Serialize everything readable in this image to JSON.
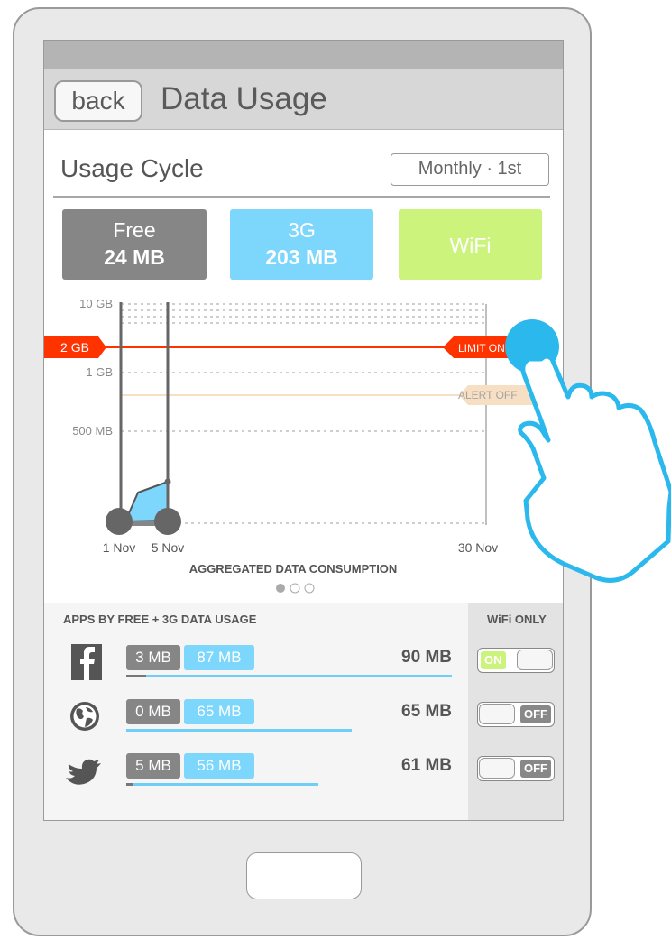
{
  "header": {
    "back_label": "back",
    "title": "Data Usage"
  },
  "cycle": {
    "label": "Usage Cycle",
    "selected": "Monthly · 1st"
  },
  "cards": {
    "free": {
      "label": "Free",
      "value": "24 MB"
    },
    "g3": {
      "label": "3G",
      "value": "203 MB"
    },
    "wifi": {
      "label": "WiFi"
    }
  },
  "chart": {
    "y_ticks": [
      "10 GB",
      "1 GB",
      "500 MB"
    ],
    "limit_value": "2 GB",
    "limit_label": "LIMIT ON",
    "alert_label": "ALERT OFF",
    "x_ticks": [
      "1 Nov",
      "5 Nov",
      "30 Nov"
    ],
    "x_title": "AGGREGATED DATA CONSUMPTION",
    "page_indicator": {
      "count": 3,
      "active": 1
    }
  },
  "chart_data": {
    "type": "area",
    "title": "",
    "xlabel": "AGGREGATED DATA CONSUMPTION",
    "ylabel": "",
    "x_range": [
      "1 Nov",
      "30 Nov"
    ],
    "y_ticks": [
      "500 MB",
      "1 GB",
      "2 GB",
      "10 GB"
    ],
    "cycle_markers": [
      "1 Nov",
      "5 Nov"
    ],
    "limit": {
      "value": "2 GB",
      "label": "LIMIT ON",
      "color": "#ff3300"
    },
    "alert": {
      "label": "ALERT OFF",
      "color": "#f7dfc4"
    },
    "series": [
      {
        "name": "3G",
        "color": "#7dd6fb"
      },
      {
        "name": "Free",
        "color": "#868686"
      }
    ]
  },
  "apps": {
    "header": "APPS BY FREE + 3G DATA USAGE",
    "wifi_header": "WiFi ONLY",
    "items": [
      {
        "icon": "facebook-icon",
        "free": "3 MB",
        "g3": "87 MB",
        "total": "90 MB",
        "wifi_only": "ON",
        "free_share": 0.04,
        "bar_share": 1.0
      },
      {
        "icon": "globe-icon",
        "free": "0 MB",
        "g3": "65 MB",
        "total": "65 MB",
        "wifi_only": "OFF",
        "free_share": 0.0,
        "bar_share": 0.72
      },
      {
        "icon": "twitter-bird-icon",
        "free": "5 MB",
        "g3": "56 MB",
        "total": "61 MB",
        "wifi_only": "OFF",
        "free_share": 0.03,
        "bar_share": 0.6
      }
    ]
  },
  "colors": {
    "free": "#868686",
    "g3": "#7dd6fb",
    "wifi": "#ccf37b",
    "limit": "#ff3300",
    "touch": "#2bb8ec"
  }
}
